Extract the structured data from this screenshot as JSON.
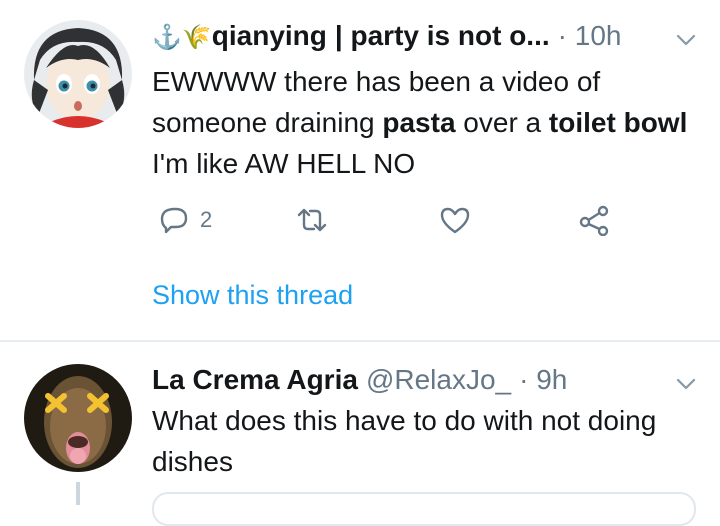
{
  "tweets": [
    {
      "emoji_prefix": "⚓🌾",
      "display_name": "qianying",
      "display_name_suffix": "| party is not o...",
      "time": "· 10h",
      "text_parts": [
        {
          "text": "EWWWW there has been a video of someone draining ",
          "bold": false
        },
        {
          "text": "pasta",
          "bold": true
        },
        {
          "text": " over a ",
          "bold": false
        },
        {
          "text": "toilet bowl",
          "bold": true
        },
        {
          "text": " I'm like AW HELL NO",
          "bold": false
        }
      ],
      "reply_count": "2",
      "show_thread": "Show this thread"
    },
    {
      "display_name": "La Crema Agria",
      "handle": "@RelaxJo_",
      "time": "· 9h",
      "text": "What does this have to do with not doing dishes"
    }
  ],
  "colors": {
    "link": "#1da1f2",
    "muted": "#657786",
    "divider": "#e6ecf0"
  },
  "icons": [
    "reply-icon",
    "retweet-icon",
    "like-icon",
    "share-icon",
    "chevron-down-icon",
    "anchor-icon",
    "rice-icon"
  ]
}
